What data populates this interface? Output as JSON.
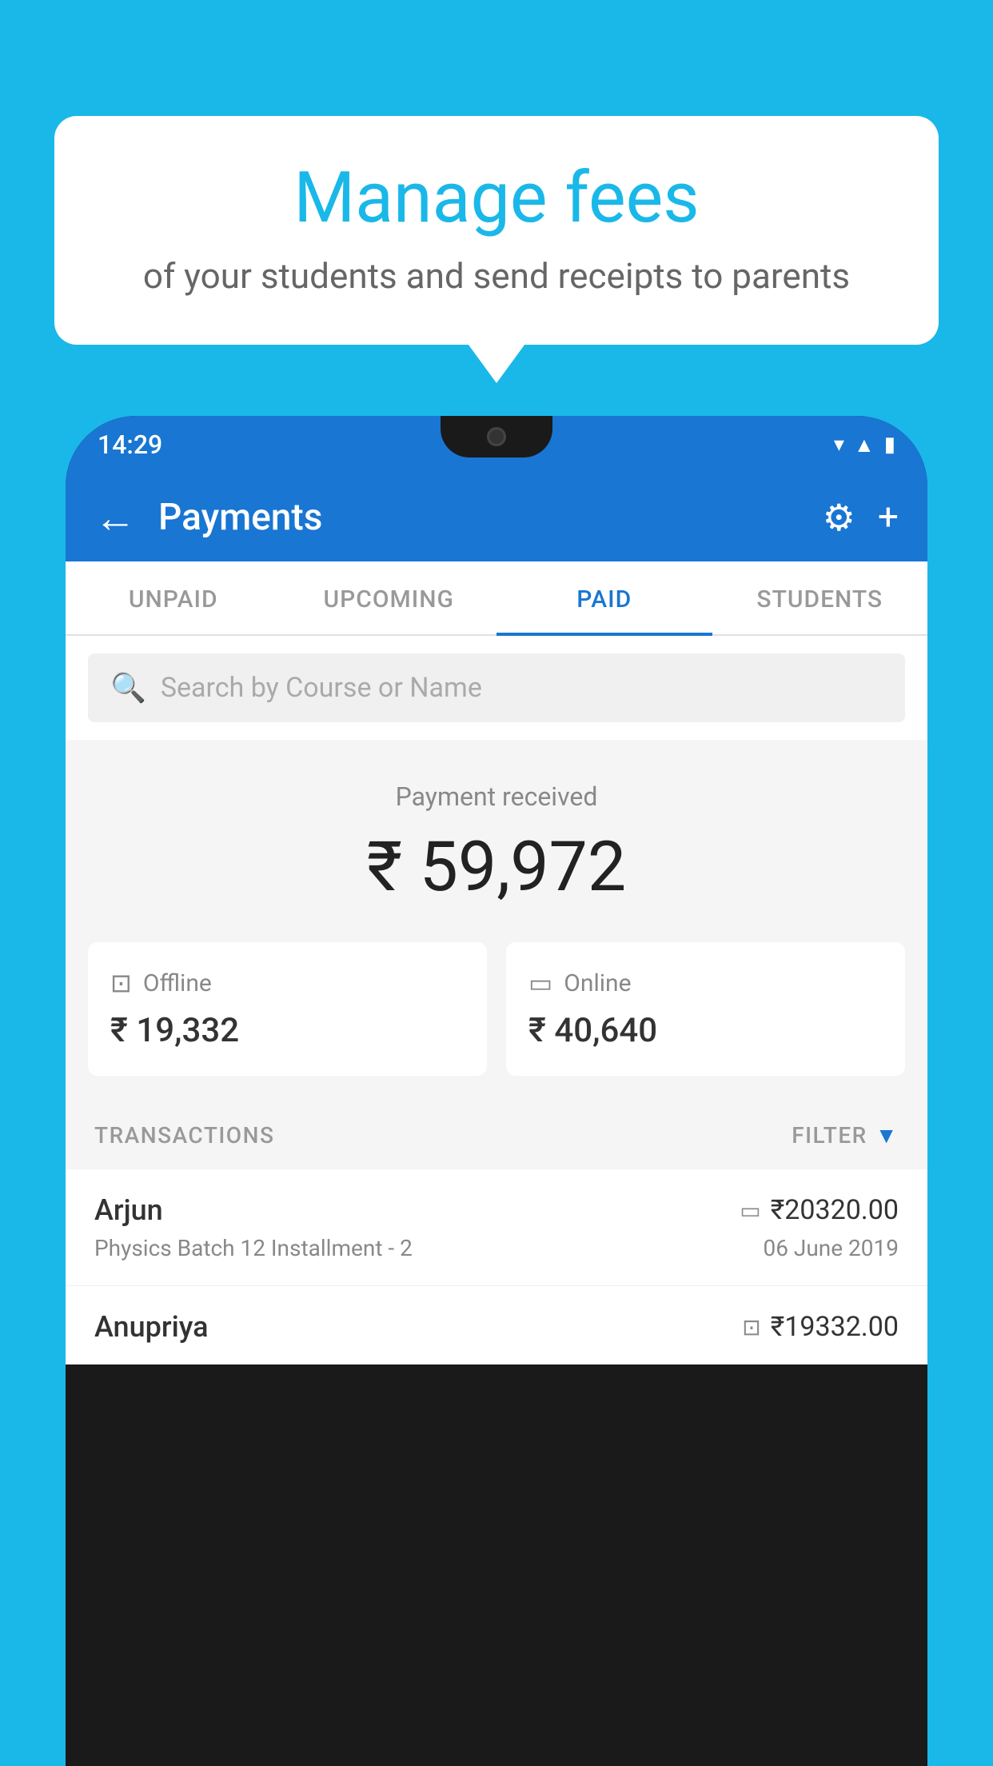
{
  "background_color": "#1ab8e8",
  "speech_bubble": {
    "title": "Manage fees",
    "subtitle": "of your students and send receipts to parents"
  },
  "status_bar": {
    "time": "14:29",
    "wifi_icon": "▼",
    "signal_icon": "▲",
    "battery_icon": "▮"
  },
  "app_bar": {
    "back_icon": "←",
    "title": "Payments",
    "settings_icon": "⚙",
    "add_icon": "+"
  },
  "tabs": [
    {
      "label": "UNPAID",
      "active": false
    },
    {
      "label": "UPCOMING",
      "active": false
    },
    {
      "label": "PAID",
      "active": true
    },
    {
      "label": "STUDENTS",
      "active": false
    }
  ],
  "search": {
    "placeholder": "Search by Course or Name"
  },
  "payment_received": {
    "label": "Payment received",
    "amount": "₹ 59,972"
  },
  "payment_cards": [
    {
      "type": "Offline",
      "amount": "₹ 19,332"
    },
    {
      "type": "Online",
      "amount": "₹ 40,640"
    }
  ],
  "transactions_section": {
    "label": "TRANSACTIONS",
    "filter_label": "FILTER"
  },
  "transactions": [
    {
      "name": "Arjun",
      "course": "Physics Batch 12 Installment - 2",
      "amount": "₹20320.00",
      "date": "06 June 2019",
      "payment_type": "online"
    },
    {
      "name": "Anupriya",
      "course": "",
      "amount": "₹19332.00",
      "date": "",
      "payment_type": "offline"
    }
  ]
}
